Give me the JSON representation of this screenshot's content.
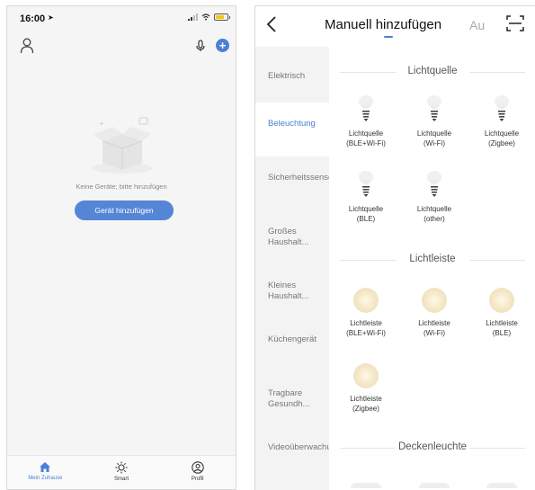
{
  "left": {
    "status_time": "16:00",
    "empty_text": "Keine Geräte; bitte hinzufügen",
    "add_device_label": "Gerät hinzufügen",
    "tabs": [
      {
        "label": "Mein Zuhause",
        "icon": "home-icon",
        "active": true
      },
      {
        "label": "Smart",
        "icon": "sun-icon",
        "active": false
      },
      {
        "label": "Profil",
        "icon": "profile-icon",
        "active": false
      }
    ],
    "accent_color": "#4a7fd6"
  },
  "right": {
    "title": "Manuell hinzufügen",
    "next_tab_partial": "Au",
    "sidebar": [
      {
        "label": "Elektrisch",
        "active": false
      },
      {
        "label": "Beleuchtung",
        "active": true
      },
      {
        "label": "Sicherheitssensor",
        "active": false
      },
      {
        "label": "Großes Haushalt...",
        "active": false
      },
      {
        "label": "Kleines Haushalt...",
        "active": false
      },
      {
        "label": "Küchengerät",
        "active": false
      },
      {
        "label": "Tragbare Gesundh...",
        "active": false
      },
      {
        "label": "Videoüberwachung",
        "active": false
      }
    ],
    "sections": [
      {
        "title": "Lichtquelle",
        "devices": [
          {
            "name": "Lichtquelle",
            "sub": "(BLE+Wi-Fi)"
          },
          {
            "name": "Lichtquelle",
            "sub": "(Wi-Fi)"
          },
          {
            "name": "Lichtquelle",
            "sub": "(Zigbee)"
          },
          {
            "name": "Lichtquelle",
            "sub": "(BLE)"
          },
          {
            "name": "Lichtquelle",
            "sub": "(other)"
          }
        ]
      },
      {
        "title": "Lichtleiste",
        "devices": [
          {
            "name": "Lichtleiste",
            "sub": "(BLE+Wi-Fi)"
          },
          {
            "name": "Lichtleiste",
            "sub": "(Wi-Fi)"
          },
          {
            "name": "Lichtleiste",
            "sub": "(BLE)"
          },
          {
            "name": "Lichtleiste",
            "sub": "(Zigbee)"
          }
        ]
      },
      {
        "title": "Deckenleuchte",
        "devices": []
      }
    ]
  }
}
